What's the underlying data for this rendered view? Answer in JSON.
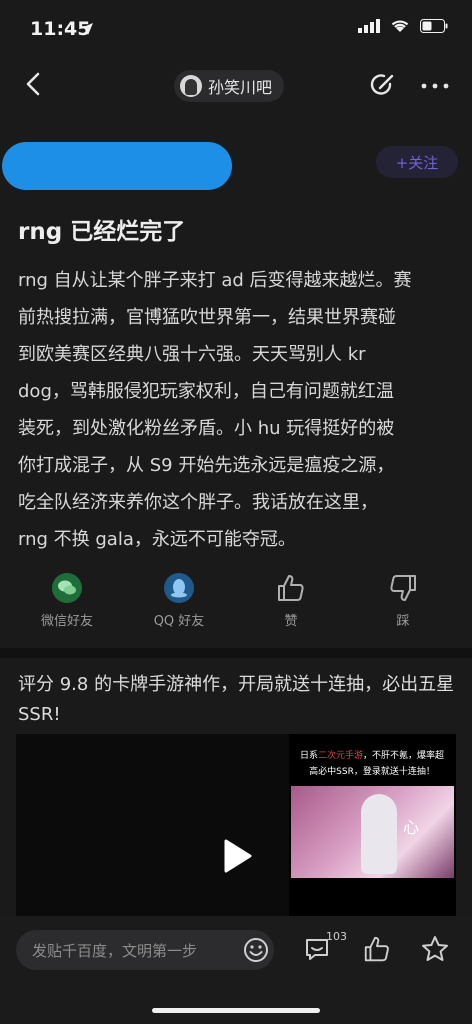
{
  "status_bar": {
    "time": "11:45"
  },
  "nav": {
    "forum_name": "孙笑川吧"
  },
  "author": {
    "follow_label": "+关注"
  },
  "post": {
    "title": "rng 已经烂完了",
    "lines": [
      "rng 自从让某个胖子来打 ad 后变得越来越烂。赛",
      "前热搜拉满，官博猛吹世界第一，结果世界赛碰",
      "到欧美赛区经典八强十六强。天天骂别人 kr",
      "dog，骂韩服侵犯玩家权利，自己有问题就红温",
      "装死，到处激化粉丝矛盾。小 hu 玩得挺好的被",
      "你打成混子，从 S9 开始先选永远是瘟疫之源，",
      "吃全队经济来养你这个胖子。我话放在这里，",
      "rng 不换 gala，永远不可能夺冠。"
    ]
  },
  "actions": [
    {
      "label": "微信好友",
      "icon": "wechat-icon"
    },
    {
      "label": "QQ 好友",
      "icon": "qq-icon"
    },
    {
      "label": "赞",
      "icon": "thumbs-up-icon"
    },
    {
      "label": "踩",
      "icon": "thumbs-down-icon"
    }
  ],
  "ad": {
    "text": "评分 9.8 的卡牌手游神作，开局就送十连抽，必出五星 SSR!",
    "caption_a": "日系",
    "caption_hl": "二次元手游",
    "caption_b": "，不肝不氪，爆率超高必中SSR，登录就送十连抽！",
    "badge": "心"
  },
  "bottom_bar": {
    "input_placeholder": "发贴千百度，文明第一步",
    "comment_count": "103"
  },
  "colors": {
    "accent": "#6c63d8",
    "blur": "#1e8fe6",
    "background": "#1a1a1b"
  }
}
